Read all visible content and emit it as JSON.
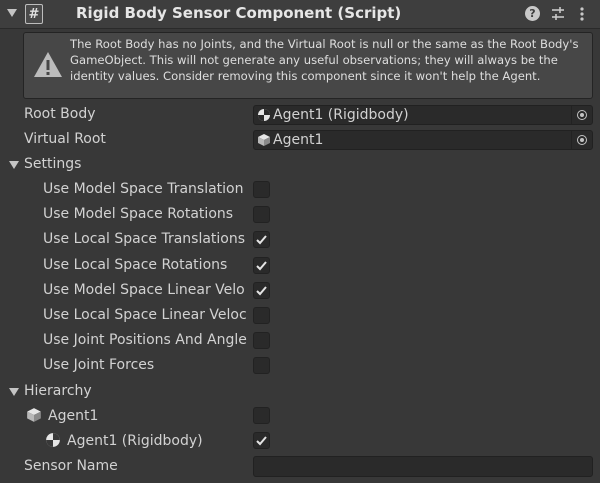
{
  "header": {
    "title": "Rigid Body Sensor Component (Script)",
    "script_icon_glyph": "#",
    "help_glyph": "?"
  },
  "warning": {
    "message": "The Root Body has no Joints, and the Virtual Root is null or the same as the Root Body's GameObject. This will not generate any useful observations; they will always be the identity values. Consider removing this component since it won't help the Agent."
  },
  "fields": {
    "root_body": {
      "label": "Root Body",
      "value": "Agent1 (Rigidbody)",
      "icon": "rigidbody-icon"
    },
    "virtual_root": {
      "label": "Virtual Root",
      "value": "Agent1",
      "icon": "gameobject-cube-icon"
    }
  },
  "settings": {
    "label": "Settings",
    "items": [
      {
        "label": "Use Model Space Translation",
        "checked": false
      },
      {
        "label": "Use Model Space Rotations",
        "checked": false
      },
      {
        "label": "Use Local Space Translations",
        "checked": true
      },
      {
        "label": "Use Local Space Rotations",
        "checked": true
      },
      {
        "label": "Use Model Space Linear Velo",
        "checked": true
      },
      {
        "label": "Use Local Space Linear Veloc",
        "checked": false
      },
      {
        "label": "Use Joint Positions And Angle",
        "checked": false
      },
      {
        "label": "Use Joint Forces",
        "checked": false
      }
    ]
  },
  "hierarchy": {
    "label": "Hierarchy",
    "items": [
      {
        "label": "Agent1",
        "icon": "gameobject-cube-icon",
        "checked": false
      },
      {
        "label": "Agent1 (Rigidbody)",
        "icon": "rigidbody-icon",
        "checked": true
      }
    ]
  },
  "sensor_name": {
    "label": "Sensor Name",
    "value": ""
  }
}
